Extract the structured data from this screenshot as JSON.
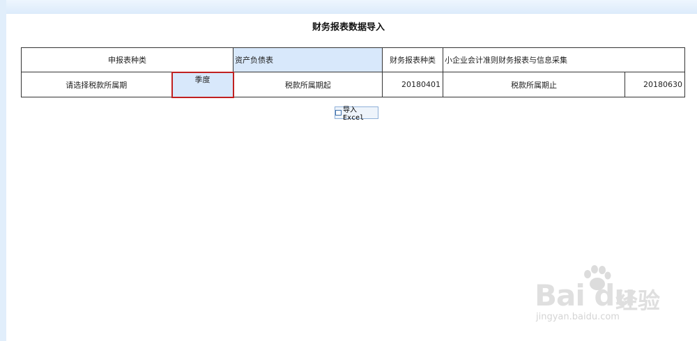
{
  "page": {
    "title": "财务报表数据导入"
  },
  "form": {
    "report_type_label": "申报表种类",
    "report_type_value": "资产负债表",
    "fin_report_type_label": "财务报表种类",
    "fin_report_type_value": "小企业会计准则财务报表与信息采集",
    "tax_period_label": "请选择税款所属期",
    "tax_period_value": "季度",
    "period_start_label": "税款所属期起",
    "period_start_value": "20180401",
    "period_end_label": "税款所属期止",
    "period_end_value": "20180630"
  },
  "actions": {
    "import_excel_label": "导入Excel"
  },
  "watermark": {
    "brand": "Bai du",
    "cn": "经验",
    "url": "jingyan.baidu.com"
  },
  "colors": {
    "highlight": "#d8e8fb",
    "selected_border": "#c02020",
    "frame": "#e1eefb"
  }
}
